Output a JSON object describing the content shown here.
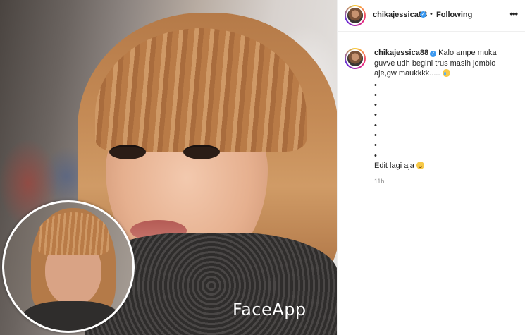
{
  "post": {
    "watermark": "FaceApp"
  },
  "header": {
    "username": "chikajessica88",
    "separator": "•",
    "follow_status": "Following",
    "more_icon": "more-horizontal-icon"
  },
  "caption": {
    "username": "chikajessica88",
    "text": "Kalo ampe muka guvve udh begini trus masih jomblo aje,gw maukkkk.....",
    "bullets": [
      "•",
      "•",
      "•",
      "•",
      "•",
      "•",
      "•",
      "•"
    ],
    "footer_text": "Edit lagi aja",
    "timestamp": "11h"
  },
  "colors": {
    "verified": "#3897f0",
    "username": "#262626",
    "timestamp": "#8e8e8e"
  }
}
